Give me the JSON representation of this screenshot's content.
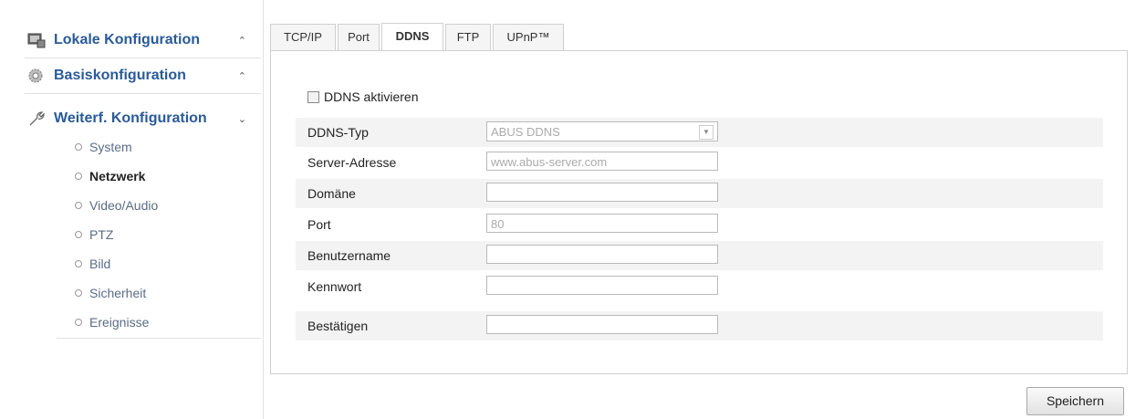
{
  "sidebar": {
    "sections": [
      {
        "title": "Lokale Konfiguration",
        "icon": "monitor-icon",
        "chevron": "^"
      },
      {
        "title": "Basiskonfiguration",
        "icon": "gear-icon",
        "chevron": "^"
      },
      {
        "title": "Weiterf. Konfiguration",
        "icon": "wrench-icon",
        "chevron": "v"
      }
    ],
    "items": [
      {
        "label": "System"
      },
      {
        "label": "Netzwerk",
        "active": true
      },
      {
        "label": "Video/Audio"
      },
      {
        "label": "PTZ"
      },
      {
        "label": "Bild"
      },
      {
        "label": "Sicherheit"
      },
      {
        "label": "Ereignisse"
      }
    ]
  },
  "tabs": [
    {
      "label": "TCP/IP"
    },
    {
      "label": "Port"
    },
    {
      "label": "DDNS",
      "active": true
    },
    {
      "label": "FTP"
    },
    {
      "label": "UPnP™"
    }
  ],
  "form": {
    "enable_label": "DDNS aktivieren",
    "enable_checked": false,
    "fields": [
      {
        "label": "DDNS-Typ",
        "value": "ABUS DDNS",
        "type": "select"
      },
      {
        "label": "Server-Adresse",
        "value": "www.abus-server.com"
      },
      {
        "label": "Domäne",
        "value": ""
      },
      {
        "label": "Port",
        "value": "80"
      },
      {
        "label": "Benutzername",
        "value": ""
      },
      {
        "label": "Kennwort",
        "value": ""
      },
      {
        "label": "Bestätigen",
        "value": ""
      }
    ]
  },
  "save_label": "Speichern"
}
